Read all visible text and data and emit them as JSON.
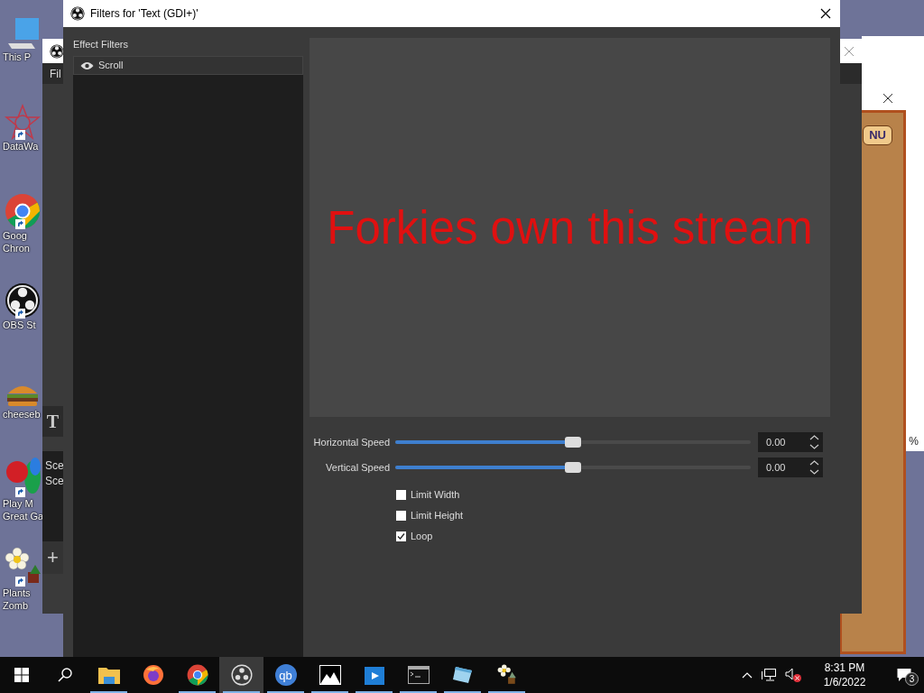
{
  "desktop_icons": [
    {
      "kind": "computer",
      "lines": [
        "This P"
      ],
      "shortcut": false
    },
    {
      "kind": "star",
      "lines": [
        "DataWa"
      ],
      "shortcut": true
    },
    {
      "kind": "chrome",
      "lines": [
        "Goog",
        "Chron"
      ],
      "shortcut": true
    },
    {
      "kind": "obs",
      "lines": [
        "OBS St"
      ],
      "shortcut": true
    },
    {
      "kind": "burger",
      "lines": [
        "cheeseb"
      ],
      "shortcut": false
    },
    {
      "kind": "balloons",
      "lines": [
        "Play M",
        "Great Ga"
      ],
      "shortcut": true
    },
    {
      "kind": "flower",
      "lines": [
        "Plants",
        "Zomb"
      ],
      "shortcut": true
    }
  ],
  "obs_main_window": {
    "menu": "Fil",
    "tool_glyph": "T",
    "scenes": [
      "Sce",
      "Sce"
    ],
    "add_glyph": "+"
  },
  "game_window": {
    "button": "NU"
  },
  "browser_window": {
    "zoom": "%"
  },
  "dialog": {
    "title": "Filters for 'Text (GDI+)'",
    "list_label": "Effect Filters",
    "filters": [
      {
        "name": "Scroll",
        "visible": true,
        "selected": true
      }
    ],
    "preview_text": "Forkies own this stream",
    "sliders": [
      {
        "label": "Horizontal Speed",
        "level": 0.5,
        "value": "0.00"
      },
      {
        "label": "Vertical Speed",
        "level": 0.5,
        "value": "0.00"
      }
    ],
    "checkboxes": [
      {
        "label": "Limit Width",
        "checked": false
      },
      {
        "label": "Limit Height",
        "checked": false
      },
      {
        "label": "Loop",
        "checked": true
      }
    ]
  },
  "taskbar": {
    "apps": [
      {
        "kind": "explorer",
        "running": true,
        "active": false
      },
      {
        "kind": "firefox",
        "running": false,
        "active": false
      },
      {
        "kind": "chrome",
        "running": true,
        "active": false
      },
      {
        "kind": "obs",
        "running": true,
        "active": true
      },
      {
        "kind": "qbittorrent",
        "text": "qb",
        "running": true,
        "active": false
      },
      {
        "kind": "photos",
        "running": true,
        "active": false
      },
      {
        "kind": "video",
        "running": true,
        "active": false
      },
      {
        "kind": "terminal",
        "running": true,
        "active": false
      },
      {
        "kind": "notes",
        "running": true,
        "active": false
      },
      {
        "kind": "flower",
        "running": true,
        "active": false
      }
    ],
    "volume_muted": true,
    "time": "8:31 PM",
    "date": "1/6/2022",
    "notifications": "3"
  }
}
